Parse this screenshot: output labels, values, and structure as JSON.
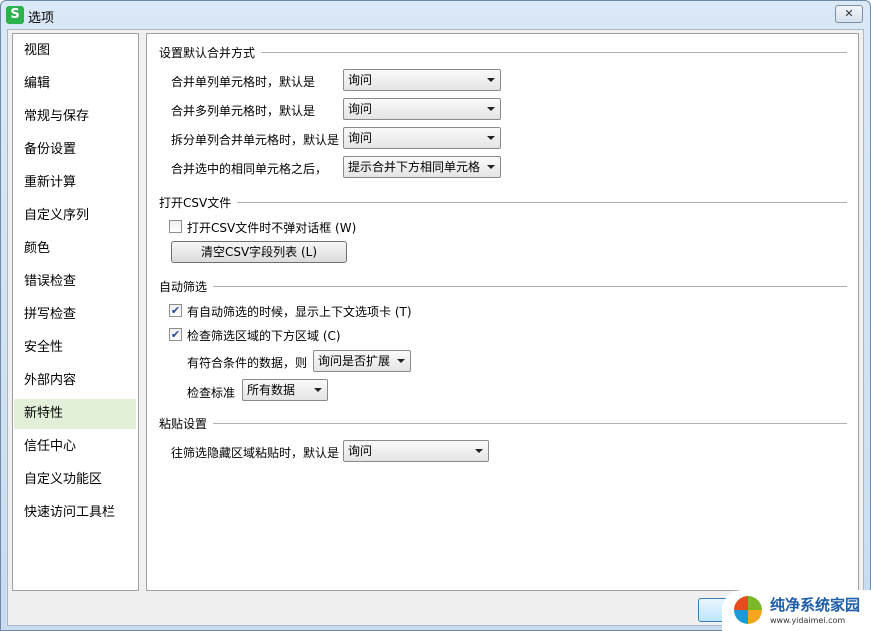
{
  "window": {
    "title": "选项",
    "logo": "S",
    "close": "✕"
  },
  "sidebar": {
    "items": [
      {
        "label": "视图"
      },
      {
        "label": "编辑"
      },
      {
        "label": "常规与保存"
      },
      {
        "label": "备份设置"
      },
      {
        "label": "重新计算"
      },
      {
        "label": "自定义序列"
      },
      {
        "label": "颜色"
      },
      {
        "label": "错误检查"
      },
      {
        "label": "拼写检查"
      },
      {
        "label": "安全性"
      },
      {
        "label": "外部内容"
      },
      {
        "label": "新特性",
        "selected": true
      },
      {
        "label": "信任中心"
      },
      {
        "label": "自定义功能区"
      },
      {
        "label": "快速访问工具栏"
      }
    ]
  },
  "merge": {
    "title": "设置默认合并方式",
    "rows": [
      {
        "label": "合并单列单元格时，默认是",
        "value": "询问"
      },
      {
        "label": "合并多列单元格时，默认是",
        "value": "询问"
      },
      {
        "label": "拆分单列合并单元格时，默认是",
        "value": "询问"
      },
      {
        "label": "合并选中的相同单元格之后，",
        "value": "提示合并下方相同单元格"
      }
    ]
  },
  "csv": {
    "title": "打开CSV文件",
    "checkbox": {
      "label": "打开CSV文件时不弹对话框 (W)",
      "checked": false
    },
    "clear_button": "清空CSV字段列表 (L)"
  },
  "autofilter": {
    "title": "自动筛选",
    "cb1": {
      "label": "有自动筛选的时候，显示上下文选项卡 (T)",
      "checked": true
    },
    "cb2": {
      "label": "检查筛选区域的下方区域 (C)",
      "checked": true
    },
    "data_label": "有符合条件的数据，则",
    "data_value": "询问是否扩展",
    "criteria_label": "检查标准",
    "criteria_value": "所有数据"
  },
  "paste": {
    "title": "粘贴设置",
    "label": "往筛选隐藏区域粘贴时，默认是",
    "value": "询问"
  },
  "watermark": {
    "text": "纯净系统家园",
    "url": "www.yidaimei.com"
  }
}
